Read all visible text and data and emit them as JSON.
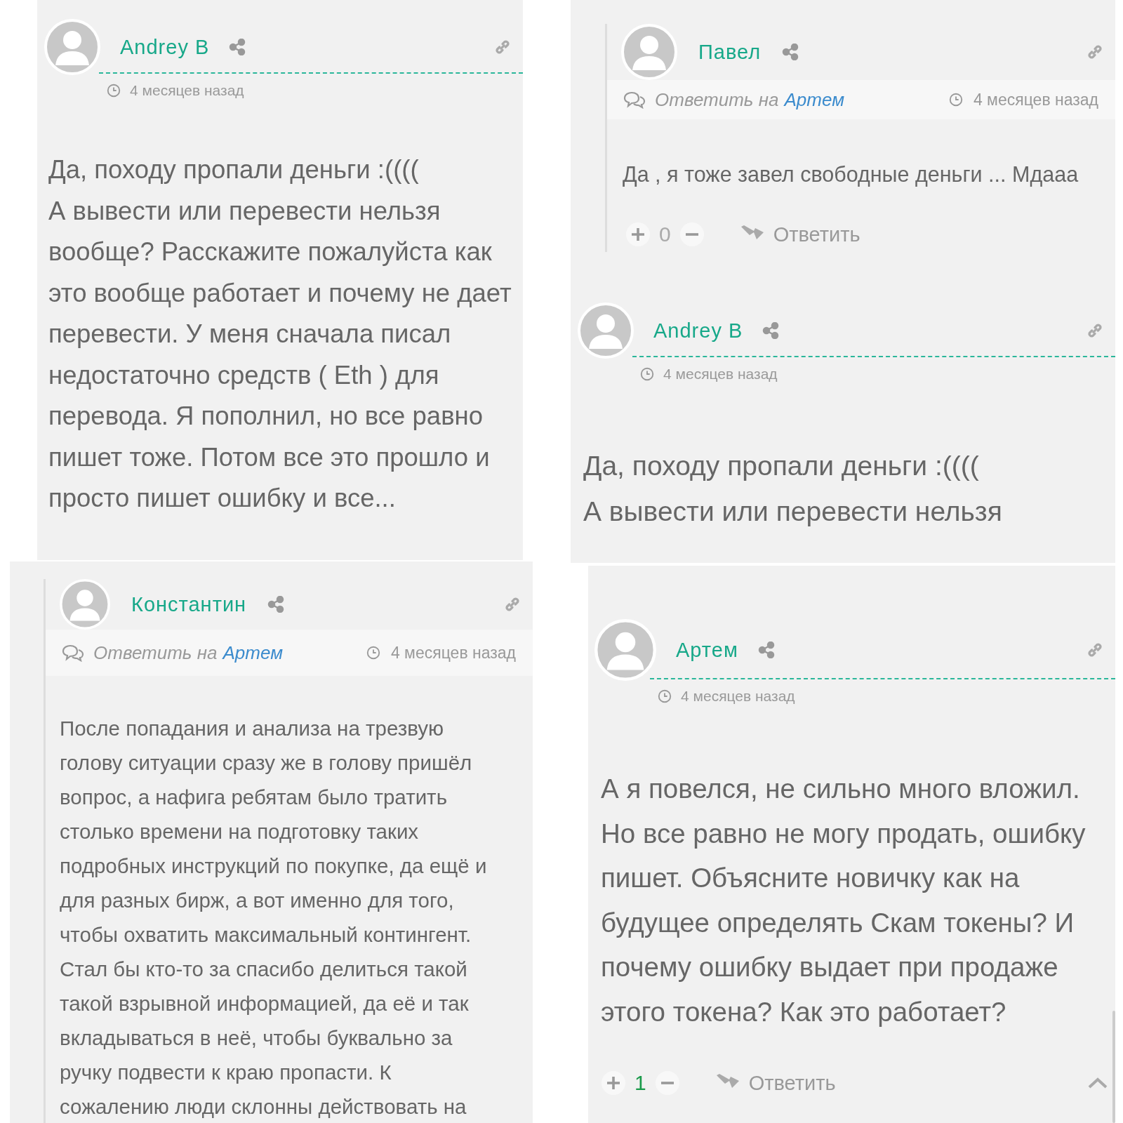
{
  "panels": [
    {
      "comments": [
        {
          "kind": "top",
          "author": "Andrey B",
          "time": "4 месяцев назад",
          "body": [
            "Да, походу пропали деньги :((((",
            "А вывести или перевести нельзя",
            "вообще? Расскажите пожалуйста как",
            "это вообще работает и почему не дает",
            "перевести. У меня сначала писал",
            "недостаточно средств ( Eth ) для",
            "перевода. Я пополнил, но все равно",
            "пишет тоже. Потом все это прошло и",
            "просто пишет ошибку и все..."
          ]
        }
      ]
    },
    {
      "comments": [
        {
          "kind": "reply",
          "author": "Павел",
          "reply_prefix": "Ответить на",
          "reply_to": "Артем",
          "time": "4 месяцев назад",
          "body": [
            "Да , я тоже завел свободные деньги ... Мдааа"
          ],
          "votes": {
            "count": "0",
            "positive": false
          },
          "reply_button": "Ответить"
        },
        {
          "kind": "top",
          "author": "Andrey B",
          "time": "4 месяцев назад",
          "body": [
            "Да, походу пропали деньги :((((",
            "А вывести или перевести нельзя"
          ]
        }
      ]
    },
    {
      "comments": [
        {
          "kind": "reply",
          "author": "Константин",
          "reply_prefix": "Ответить на",
          "reply_to": "Артем",
          "time": "4 месяцев назад",
          "body": [
            "После попадания и анализа на трезвую",
            "голову ситуации сразу же в голову пришёл",
            "вопрос, а нафига ребятам было тратить",
            "столько времени на подготовку таких",
            "подробных инструкций по покупке, да ещё и",
            "для разных бирж, а вот именно для того,",
            "чтобы охватить максимальный контингент.",
            "Стал бы кто-то за спасибо делиться такой",
            "такой взрывной информацией, да её и так",
            "вкладываться в неё, чтобы буквально за",
            "ручку подвести к краю пропасти. К",
            "сожалению люди склонны действовать на"
          ]
        }
      ]
    },
    {
      "back_to_top": true,
      "comments": [
        {
          "kind": "top",
          "author": "Артем",
          "time": "4 месяцев назад",
          "body": [
            "А я повелся, не сильно много вложил.",
            "Но все равно не могу продать, ошибку",
            "пишет. Объясните новичку как на",
            "будущее определять Скам токены? И",
            "почему ошибку выдает при продаже",
            "этого токена? Как это работает?"
          ],
          "votes": {
            "count": "1",
            "positive": true
          },
          "reply_button": "Ответить"
        }
      ]
    }
  ]
}
